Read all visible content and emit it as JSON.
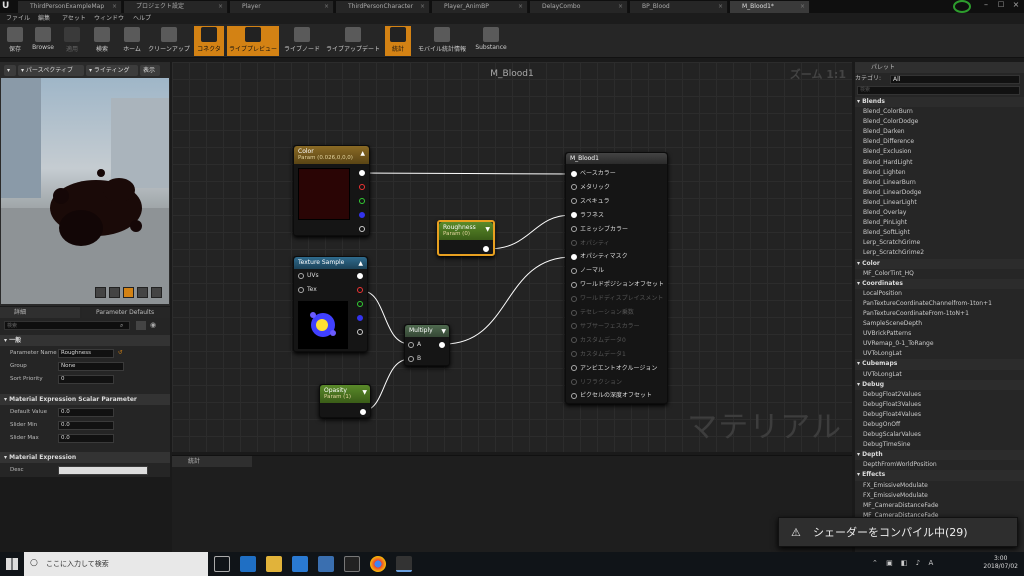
{
  "tabs": [
    "ThirdPersonExampleMap",
    "プロジェクト設定",
    "Player",
    "ThirdPersonCharacter",
    "Player_AnimBP",
    "DelayCombo",
    "BP_Blood",
    "M_Blood1*"
  ],
  "menu": [
    "ファイル",
    "編集",
    "アセット",
    "ウィンドウ",
    "ヘルプ"
  ],
  "toolbar": [
    {
      "label": "保存",
      "state": "normal"
    },
    {
      "label": "Browse",
      "state": "normal"
    },
    {
      "label": "適用",
      "state": "dim"
    },
    {
      "label": "検索",
      "state": "normal"
    },
    {
      "label": "ホーム",
      "state": "normal"
    },
    {
      "label": "クリーンアップ",
      "state": "normal"
    },
    {
      "label": "コネクタ",
      "state": "active"
    },
    {
      "label": "ライブプレビュー",
      "state": "active"
    },
    {
      "label": "ライブノード",
      "state": "normal"
    },
    {
      "label": "ライブアップデート",
      "state": "normal"
    },
    {
      "label": "統計",
      "state": "active"
    },
    {
      "label": "モバイル統計情報",
      "state": "normal"
    },
    {
      "label": "Substance",
      "state": "normal"
    }
  ],
  "viewport": {
    "perspective": "パースペクティブ",
    "lighting": "ライティング",
    "show": "表示"
  },
  "details": {
    "tab1": "詳細",
    "tab2": "Parameter Defaults",
    "search_placeholder": "検索",
    "sec_general": "一般",
    "param_name_label": "Parameter Name",
    "param_name_value": "Roughness",
    "group_label": "Group",
    "group_value": "None",
    "sort_label": "Sort Priority",
    "sort_value": "0",
    "sec_scalar": "Material Expression Scalar Parameter",
    "default_label": "Default Value",
    "default_value": "0.0",
    "min_label": "Slider Min",
    "min_value": "0.0",
    "max_label": "Slider Max",
    "max_value": "0.0",
    "sec_expr": "Material Expression",
    "desc_label": "Desc"
  },
  "graph": {
    "title": "M_Blood1",
    "zoom": "ズーム 1:1",
    "watermark": "マテリアル",
    "color_node": {
      "title": "Color",
      "sub": "Param (0.026,0,0,0)",
      "swatch": "#2a0505"
    },
    "texture_node": {
      "title": "Texture Sample",
      "pins": [
        "UVs",
        "Tex"
      ]
    },
    "roughness_node": {
      "title": "Roughness",
      "sub": "Param (0)"
    },
    "multiply_node": {
      "title": "Multiply",
      "pins": [
        "A",
        "B"
      ]
    },
    "opacity_node": {
      "title": "Opasity",
      "sub": "Param (1)"
    },
    "result_node": {
      "title": "M_Blood1",
      "pins": [
        {
          "label": "ベースカラー",
          "state": "on"
        },
        {
          "label": "メタリック",
          "state": "off"
        },
        {
          "label": "スペキュラ",
          "state": "off"
        },
        {
          "label": "ラフネス",
          "state": "on"
        },
        {
          "label": "エミッシブカラー",
          "state": "off"
        },
        {
          "label": "オパシティ",
          "state": "dis"
        },
        {
          "label": "オパシティマスク",
          "state": "on"
        },
        {
          "label": "ノーマル",
          "state": "off"
        },
        {
          "label": "ワールドポジションオフセット",
          "state": "off"
        },
        {
          "label": "ワールドディスプレイスメント",
          "state": "dis"
        },
        {
          "label": "テセレーション乗数",
          "state": "dis"
        },
        {
          "label": "サブサーフェスカラー",
          "state": "dis"
        },
        {
          "label": "カスタムデータ0",
          "state": "dis"
        },
        {
          "label": "カスタムデータ1",
          "state": "dis"
        },
        {
          "label": "アンビエントオクルージョン",
          "state": "off"
        },
        {
          "label": "リフラクション",
          "state": "dis"
        },
        {
          "label": "ピクセルの深度オフセット",
          "state": "off"
        }
      ]
    }
  },
  "stats": {
    "tab": "統計"
  },
  "palette": {
    "tab": "パレット",
    "category_label": "カテゴリ:",
    "category_value": "All",
    "search_placeholder": "検索",
    "groups": [
      {
        "name": "Blends",
        "items": [
          "Blend_ColorBurn",
          "Blend_ColorDodge",
          "Blend_Darken",
          "Blend_Difference",
          "Blend_Exclusion",
          "Blend_HardLight",
          "Blend_Lighten",
          "Blend_LinearBurn",
          "Blend_LinearDodge",
          "Blend_LinearLight",
          "Blend_Overlay",
          "Blend_PinLight",
          "Blend_SoftLight",
          "Lerp_ScratchGrime",
          "Lerp_ScratchGrime2"
        ]
      },
      {
        "name": "Color",
        "items": [
          "MF_ColorTint_HQ"
        ]
      },
      {
        "name": "Coordinates",
        "items": [
          "LocalPosition",
          "PanTextureCoordinateChannelfrom-1ton+1",
          "PanTextureCoordinateFrom-1toN+1",
          "SampleSceneDepth",
          "UVBrickPatterns",
          "UVRemap_0-1_ToRange",
          "UVToLongLat"
        ]
      },
      {
        "name": "Cubemaps",
        "items": [
          "UVToLongLat"
        ]
      },
      {
        "name": "Debug",
        "items": [
          "DebugFloat2Values",
          "DebugFloat3Values",
          "DebugFloat4Values",
          "DebugOnOff",
          "DebugScalarValues",
          "DebugTimeSine"
        ]
      },
      {
        "name": "Depth",
        "items": [
          "DepthFromWorldPosition"
        ]
      },
      {
        "name": "Effects",
        "items": [
          "FX_EmissiveModulate",
          "FX_EmissiveModulate",
          "MF_CameraDistanceFade",
          "MF_CameraDistanceFade"
        ]
      }
    ]
  },
  "toast": "シェーダーをコンパイル中(29)",
  "taskbar": {
    "search": "ここに入力して検索",
    "time": "3:00",
    "date": "2018/07/02"
  }
}
